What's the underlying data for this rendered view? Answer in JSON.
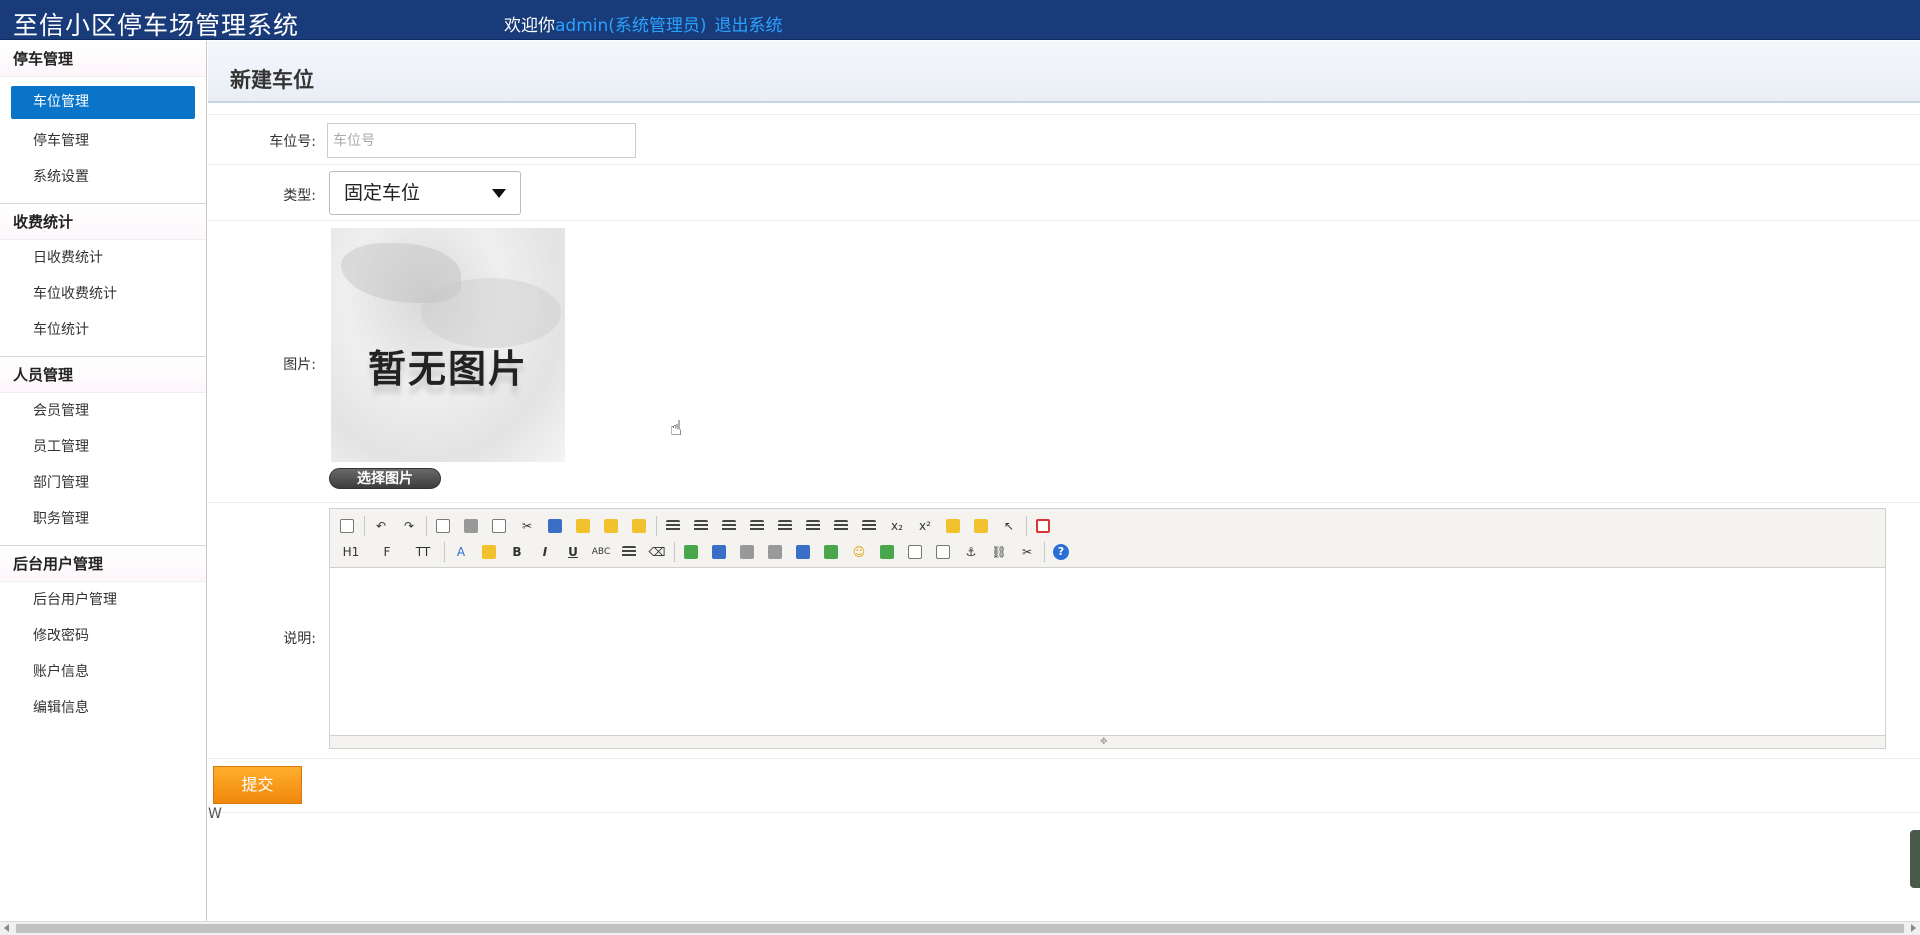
{
  "header": {
    "app_title": "至信小区停车场管理系统",
    "welcome_prefix": "欢迎你",
    "user": "admin(系统管理员)",
    "logout": "退出系统"
  },
  "sidebar": {
    "groups": [
      {
        "title": "停车管理",
        "items": [
          "车位管理",
          "停车管理",
          "系统设置"
        ]
      },
      {
        "title": "收费统计",
        "items": [
          "日收费统计",
          "车位收费统计",
          "车位统计"
        ]
      },
      {
        "title": "人员管理",
        "items": [
          "会员管理",
          "员工管理",
          "部门管理",
          "职务管理"
        ]
      },
      {
        "title": "后台用户管理",
        "items": [
          "后台用户管理",
          "修改密码",
          "账户信息",
          "编辑信息"
        ]
      }
    ],
    "active_item": "车位管理"
  },
  "page": {
    "title": "新建车位",
    "fields": {
      "number_label": "车位号:",
      "number_placeholder": "车位号",
      "number_value": "",
      "type_label": "类型:",
      "type_value": "固定车位",
      "image_label": "图片:",
      "image_placeholder_text": "暂无图片",
      "choose_image": "选择图片",
      "desc_label": "说明:"
    },
    "editor": {
      "heading_btn": "H1",
      "font_btn": "F",
      "size_btn": "TT",
      "bold": "B",
      "italic": "I",
      "underline": "U",
      "strike": "ABC",
      "subscript": "x₂",
      "superscript": "x²",
      "help": "?",
      "content": ""
    },
    "submit": "提交",
    "stray_text": "W"
  },
  "colors": {
    "topbar": "#1a3b7a",
    "active_nav": "#0a74c9",
    "submit": "#f0880c"
  }
}
